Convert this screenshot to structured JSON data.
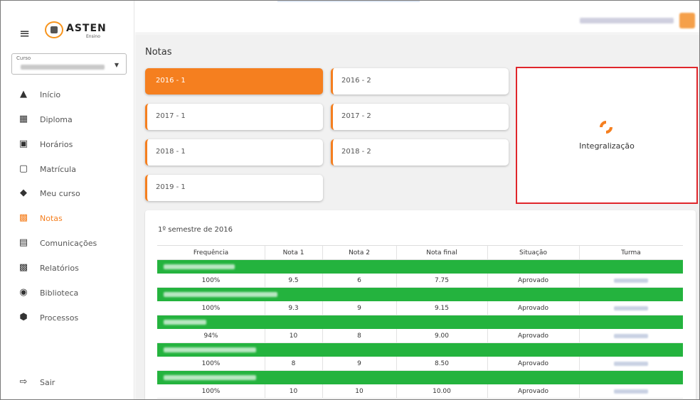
{
  "brand": {
    "name": "ASTEN",
    "sub": "Ensino"
  },
  "course": {
    "label": "Curso"
  },
  "nav": [
    {
      "label": "Início",
      "icon": "home-icon"
    },
    {
      "label": "Diploma",
      "icon": "diploma-icon"
    },
    {
      "label": "Horários",
      "icon": "calendar-clock-icon"
    },
    {
      "label": "Matrícula",
      "icon": "document-icon"
    },
    {
      "label": "Meu curso",
      "icon": "graduation-cap-icon"
    },
    {
      "label": "Notas",
      "icon": "grades-card-icon",
      "active": true
    },
    {
      "label": "Comunicações",
      "icon": "message-icon"
    },
    {
      "label": "Relatórios",
      "icon": "report-icon"
    },
    {
      "label": "Biblioteca",
      "icon": "library-icon"
    },
    {
      "label": "Processos",
      "icon": "box-icon"
    }
  ],
  "logout": {
    "label": "Sair",
    "icon": "logout-icon"
  },
  "page": {
    "title": "Notas"
  },
  "semesters": [
    {
      "label": "2016 - 1",
      "active": true
    },
    {
      "label": "2016 - 2"
    },
    {
      "label": "2017 - 1"
    },
    {
      "label": "2017 - 2"
    },
    {
      "label": "2018 - 1"
    },
    {
      "label": "2018 - 2"
    },
    {
      "label": "2019 - 1"
    }
  ],
  "integralizacao": {
    "label": "Integralização",
    "icon": "pie-progress-icon"
  },
  "grades": {
    "title": "1º semestre de 2016",
    "columns": [
      "Frequência",
      "Nota 1",
      "Nota 2",
      "Nota final",
      "Situação",
      "Turma"
    ],
    "rows": [
      {
        "frequencia": "100%",
        "nota1": "9.5",
        "nota2": "6",
        "final": "7.75",
        "situacao": "Aprovado"
      },
      {
        "frequencia": "100%",
        "nota1": "9.3",
        "nota2": "9",
        "final": "9.15",
        "situacao": "Aprovado"
      },
      {
        "frequencia": "94%",
        "nota1": "10",
        "nota2": "8",
        "final": "9.00",
        "situacao": "Aprovado"
      },
      {
        "frequencia": "100%",
        "nota1": "8",
        "nota2": "9",
        "final": "8.50",
        "situacao": "Aprovado"
      },
      {
        "frequencia": "100%",
        "nota1": "10",
        "nota2": "10",
        "final": "10.00",
        "situacao": "Aprovado"
      }
    ]
  },
  "colors": {
    "accent": "#f57f1f",
    "group_row": "#24b33e",
    "highlight_border": "#e0262b"
  }
}
